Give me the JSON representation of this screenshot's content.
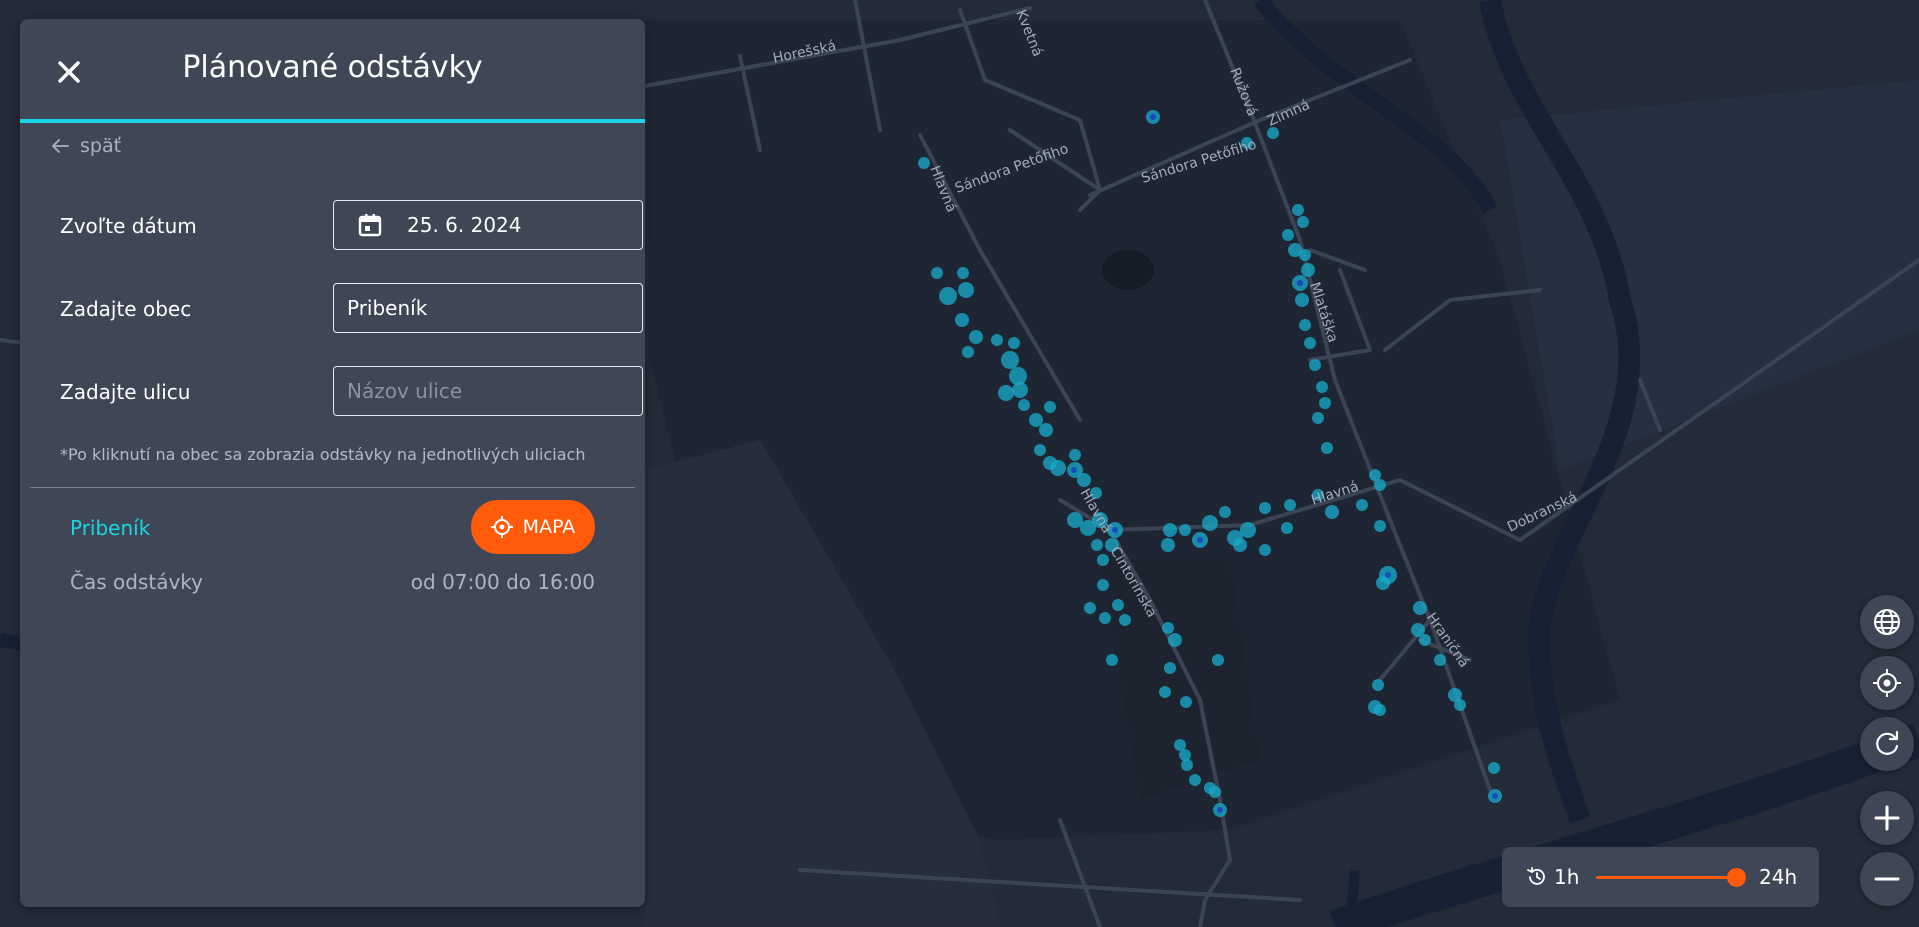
{
  "panel": {
    "title": "Plánované odstávky",
    "close_icon": "close-icon",
    "back_label": "späť",
    "date_label": "Zvoľte dátum",
    "date_value": "25. 6. 2024",
    "town_label": "Zadajte obec",
    "town_value": "Pribeník",
    "street_label": "Zadajte ulicu",
    "street_placeholder": "Názov ulice",
    "note": "*Po kliknutí na obec sa zobrazia odstávky na jednotlivých uliciach",
    "result": {
      "name": "Pribeník",
      "map_button_label": "MAPA",
      "time_label": "Čas odstávky",
      "time_value": "od 07:00 do 16:00"
    }
  },
  "map": {
    "street_labels": {
      "horesska": "Horešská",
      "kvetna": "Kvetná",
      "ruzova": "Ružová",
      "zimna": "Zimná",
      "petofiho_1": "Sándora Petőfiho",
      "petofiho_2": "Sándora Petőfiho",
      "hlavna_1": "Hlavná",
      "hlavna_2": "Hlavná",
      "hlavna_3": "Hlavná",
      "mlataska": "Mlatáška",
      "cintorinska": "Cintorínska",
      "dobranska": "Dobranská",
      "hranicna": "Hraničná"
    },
    "controls": [
      "globe-icon",
      "locate-icon",
      "refresh-icon",
      "zoom-in-icon",
      "zoom-out-icon"
    ]
  },
  "time_slider": {
    "min_label": "1h",
    "max_label": "24h",
    "value_fraction": 0.97
  },
  "colors": {
    "accent_cyan": "#18d6e4",
    "accent_orange": "#ff5b0a",
    "panel_bg": "#3f4656",
    "map_bg": "#232b38"
  }
}
